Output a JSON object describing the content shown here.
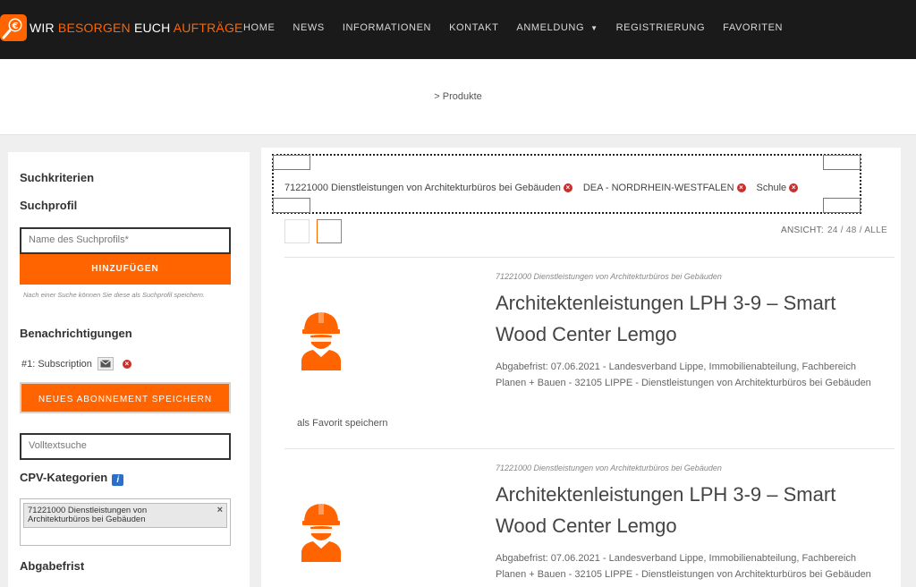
{
  "header": {
    "logo_parts": [
      {
        "text": "WIR ",
        "accent": false
      },
      {
        "text": "BESORGEN",
        "accent": true
      },
      {
        "text": " EUCH ",
        "accent": false
      },
      {
        "text": "AUFTRÄGE",
        "accent": true
      }
    ],
    "nav": [
      {
        "label": "HOME",
        "has_dropdown": false
      },
      {
        "label": "NEWS",
        "has_dropdown": false
      },
      {
        "label": "INFORMATIONEN",
        "has_dropdown": false
      },
      {
        "label": "KONTAKT",
        "has_dropdown": false
      },
      {
        "label": "ANMELDUNG",
        "has_dropdown": true
      },
      {
        "label": "REGISTRIERUNG",
        "has_dropdown": false
      },
      {
        "label": "FAVORITEN",
        "has_dropdown": false
      }
    ]
  },
  "breadcrumb": {
    "separator": ">",
    "current": "Produkte"
  },
  "sidebar": {
    "suchkriterien": "Suchkriterien",
    "suchprofil": "Suchprofil",
    "profile_name_placeholder": "Name des Suchprofils*",
    "add_button": "HINZUFÜGEN",
    "hint": "Nach einer Suche können Sie diese als Suchprofil speichern.",
    "benachrichtigungen": "Benachrichtigungen",
    "subscription": "#1: Subscription",
    "save_subscription_button": "NEUES ABONNEMENT SPEICHERN",
    "volltext_placeholder": "Volltextsuche",
    "cpv_heading": "CPV-Kategorien",
    "cpv_tag": "71221000 Dienstleistungen von Architekturbüros bei Gebäuden",
    "abgabefrist": "Abgabefrist"
  },
  "filters": [
    "71221000 Dienstleistungen von Architekturbüros bei Gebäuden",
    "DEA - NORDRHEIN-WESTFALEN",
    "Schule"
  ],
  "view": {
    "label": "ANSICHT:",
    "options": "24 / 48 / ALLE"
  },
  "results": [
    {
      "category": "71221000 Dienstleistungen von Architekturbüros bei Gebäuden",
      "title": "Architektenleistungen LPH 3-9 – Smart Wood Center Lemgo",
      "description": "Abgabefrist: 07.06.2021 - Landesverband Lippe, Immobilienabteilung, Fachbereich Planen + Bauen - 32105 LIPPE - Dienstleistungen von Architekturbüros bei Gebäuden",
      "favorite_label": "als Favorit speichern"
    },
    {
      "category": "71221000 Dienstleistungen von Architekturbüros bei Gebäuden",
      "title": "Architektenleistungen LPH 3-9 – Smart Wood Center Lemgo",
      "description": "Abgabefrist: 07.06.2021 - Landesverband Lippe, Immobilienabteilung, Fachbereich Planen + Bauen - 32105 LIPPE - Dienstleistungen von Architekturbüros bei Gebäuden"
    }
  ],
  "colors": {
    "accent": "#ff6400",
    "nav_bg": "#1a1a1a",
    "remove": "#c9302c"
  },
  "icons": [
    "logo-magnifier-euro-icon",
    "chevron-down-icon",
    "envelope-icon",
    "remove-icon",
    "info-icon",
    "worker-helmet-icon"
  ]
}
